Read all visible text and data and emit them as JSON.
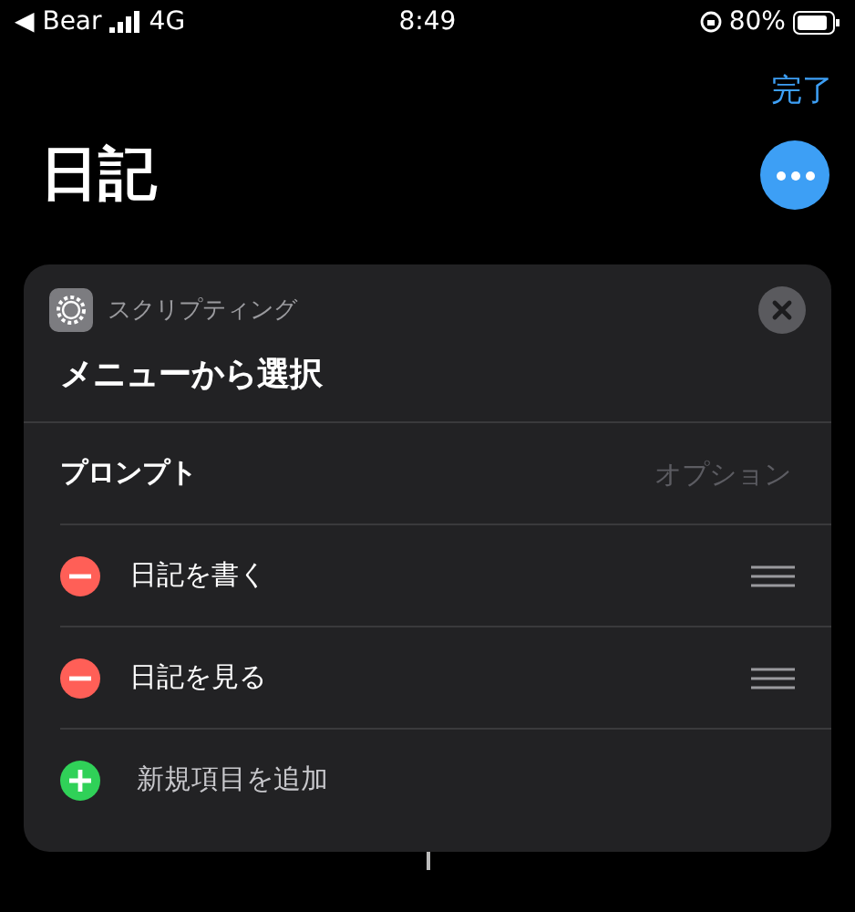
{
  "status_bar": {
    "back_app": "◀ Bear",
    "network": "4G",
    "time": "8:49",
    "battery": "80%"
  },
  "nav": {
    "done": "完了"
  },
  "page_title": "日記",
  "action": {
    "category": "スクリプティング",
    "title": "メニューから選択",
    "prompt_label": "プロンプト",
    "prompt_placeholder": "オプション",
    "items": [
      {
        "kind": "item",
        "label": "日記を書く"
      },
      {
        "kind": "item",
        "label": "日記を見る"
      },
      {
        "kind": "add",
        "label": "新規項目を追加"
      }
    ]
  }
}
